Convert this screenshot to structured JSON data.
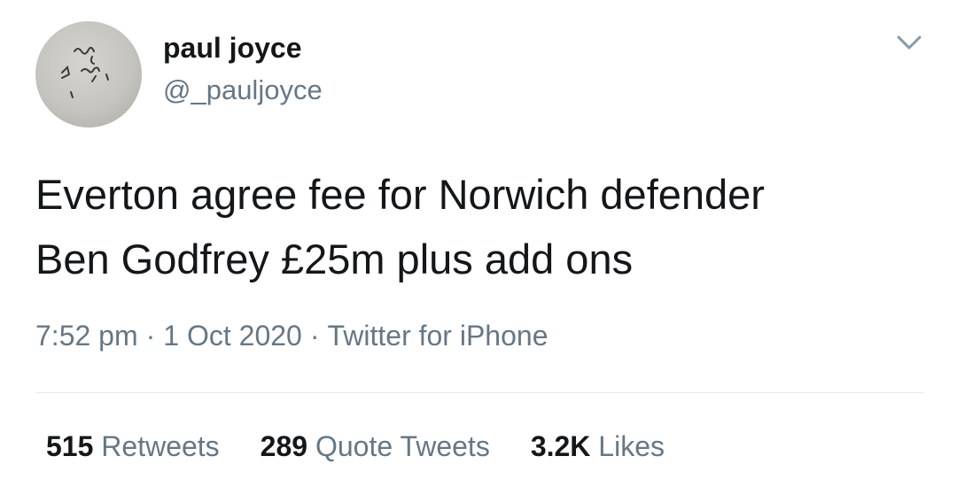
{
  "user": {
    "display_name": "paul joyce",
    "handle": "@_pauljoyce",
    "avatar_icon": "handwritten-note-avatar"
  },
  "tweet": {
    "text": "Everton agree fee for Norwich defender\nBen Godfrey £25m plus add ons",
    "time": "7:52 pm",
    "date": "1 Oct 2020",
    "source": "Twitter for iPhone",
    "separator": "·"
  },
  "menu": {
    "icon": "chevron-down-icon"
  },
  "stats": {
    "retweets_count": "515",
    "retweets_label": "Retweets",
    "quotes_count": "289",
    "quotes_label": "Quote Tweets",
    "likes_count": "3.2K",
    "likes_label": "Likes"
  },
  "colors": {
    "text_primary": "#14171a",
    "text_secondary": "#657786",
    "divider": "#e1e8ed",
    "background": "#ffffff"
  }
}
